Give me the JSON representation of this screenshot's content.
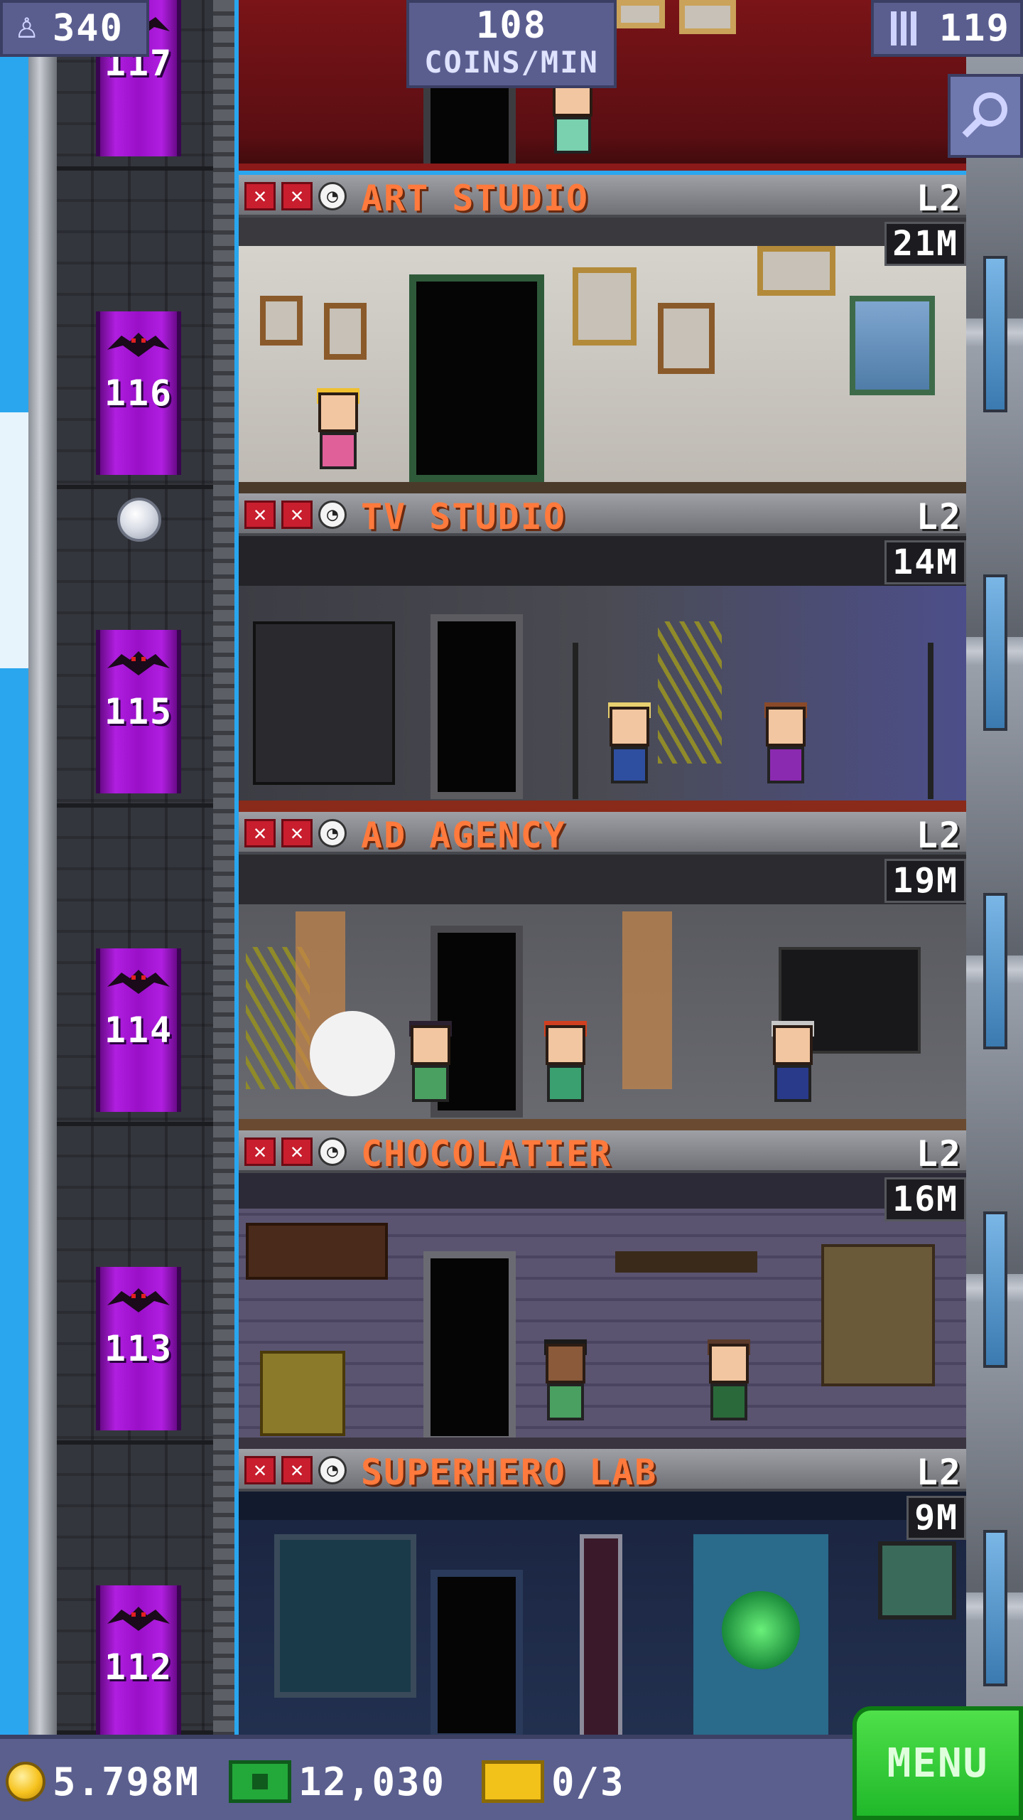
{
  "hud": {
    "population": "340",
    "coins_rate_value": "108",
    "coins_rate_unit": "COINS/MIN",
    "floor_count": "119"
  },
  "top_floor": {
    "elevator_label": "117"
  },
  "floors": [
    {
      "name": "ART STUDIO",
      "level": "L2",
      "earnings": "21M",
      "elevator_label": "116"
    },
    {
      "name": "TV STUDIO",
      "level": "L2",
      "earnings": "14M",
      "elevator_label": "115"
    },
    {
      "name": "AD AGENCY",
      "level": "L2",
      "earnings": "19M",
      "elevator_label": "114"
    },
    {
      "name": "CHOCOLATIER",
      "level": "L2",
      "earnings": "16M",
      "elevator_label": "113"
    },
    {
      "name": "SUPERHERO LAB",
      "level": "L2",
      "earnings": "9M",
      "elevator_label": "112"
    }
  ],
  "bottom_bar": {
    "coins": "5.798M",
    "bux": "12,030",
    "tickets": "0/3",
    "menu_label": "MENU"
  },
  "icons": {
    "population": "person-icon",
    "floors": "building-icon",
    "search": "magnifier-icon",
    "coin": "coin-icon",
    "bux": "bux-icon",
    "ticket": "ticket-icon",
    "stock_status": "x-icon",
    "timer": "clock-icon",
    "elevator_mascot": "bat-icon"
  },
  "colors": {
    "sky": "#2aa6ee",
    "elevator": "#b01ee0",
    "floor_title": "#ff7a3c",
    "hud": "#5a5e8f",
    "menu": "#2fcc2f"
  }
}
